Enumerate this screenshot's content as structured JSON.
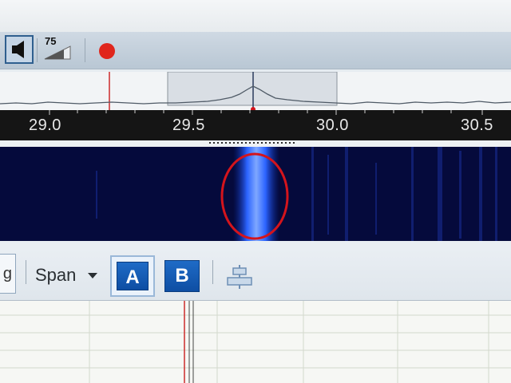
{
  "toolbar": {
    "speaker_icon": "speaker-icon",
    "volume_value": "75",
    "record_icon": "record-dot-icon"
  },
  "frequency_scale": {
    "ticks": [
      "29.0",
      "29.5",
      "30.0",
      "30.5"
    ]
  },
  "bottom_bar": {
    "partial_label": "g",
    "span_label": "Span",
    "button_a": "A",
    "button_b": "B",
    "align_icon": "align-center-icon"
  },
  "colors": {
    "waterfall_background": "#050a3c",
    "signal": "#2f6dff",
    "annotation_circle": "#d4141c",
    "record_dot": "#e0261c",
    "toggle_active": "#1a5fb4"
  }
}
